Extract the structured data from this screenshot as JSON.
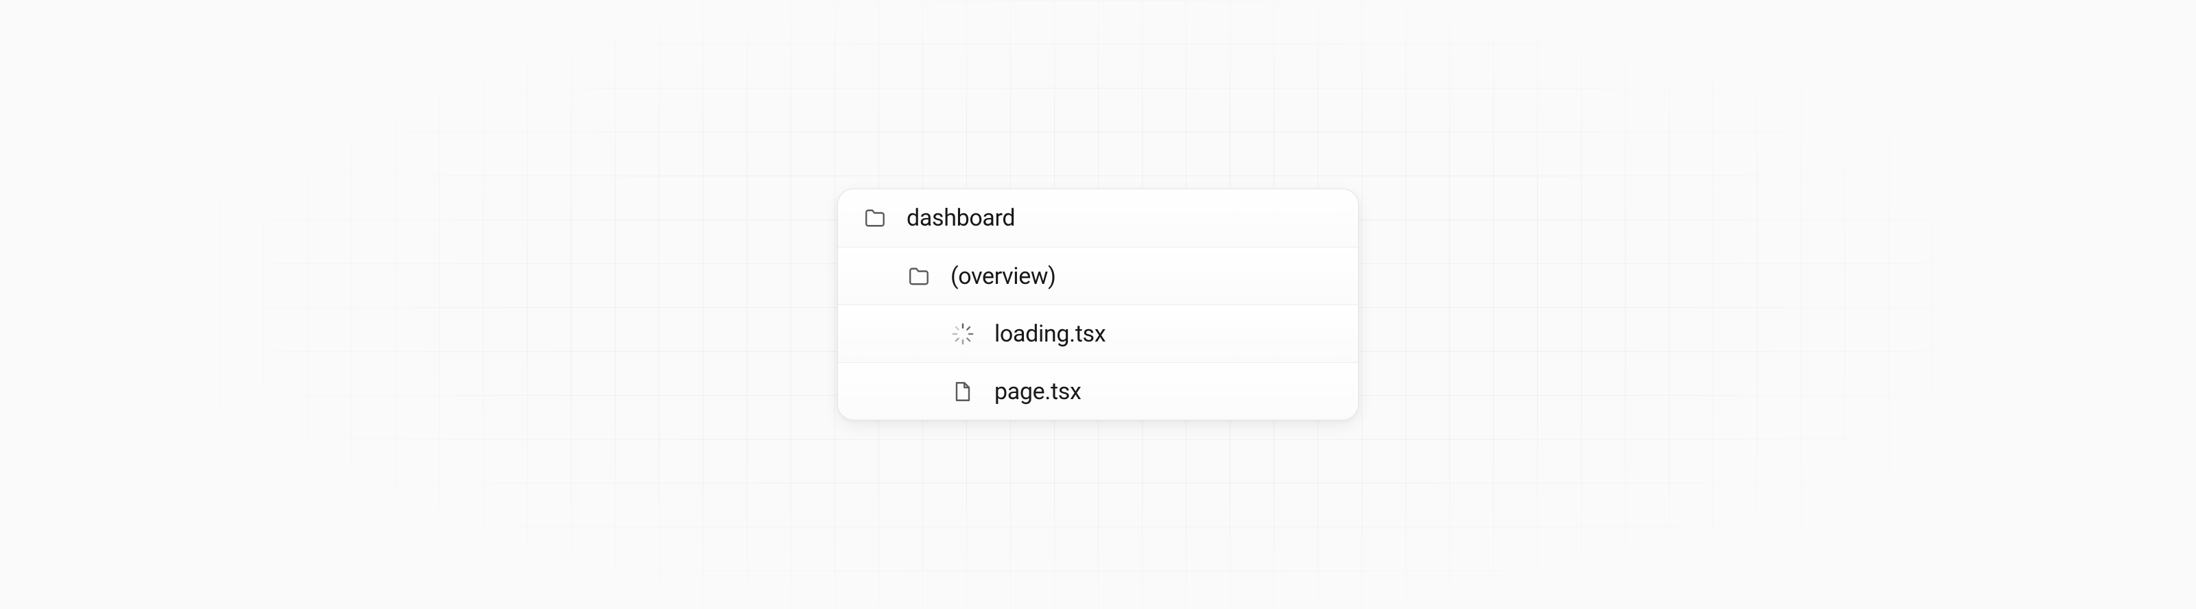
{
  "tree": {
    "dashboard": {
      "label": "dashboard",
      "icon": "folder"
    },
    "overview": {
      "label": "(overview)",
      "icon": "folder"
    },
    "loading": {
      "label": "loading.tsx",
      "icon": "spinner"
    },
    "page": {
      "label": "page.tsx",
      "icon": "file"
    }
  }
}
